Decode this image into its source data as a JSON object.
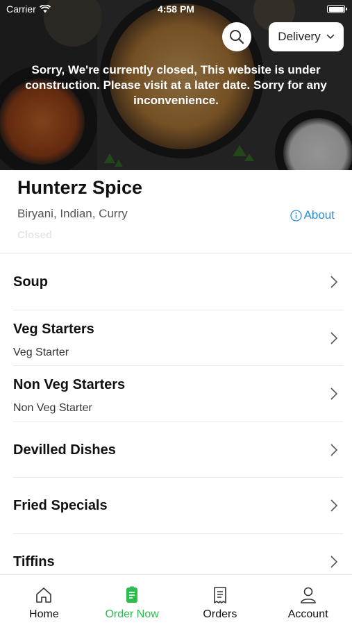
{
  "status_bar": {
    "carrier": "Carrier",
    "time": "4:58 PM",
    "battery_level": 1.0
  },
  "header": {
    "search_icon": "search-icon",
    "order_mode": "Delivery",
    "closed_message": "Sorry, We're currently closed, This website is under construction. Please visit at a later date. Sorry for any inconvenience."
  },
  "restaurant": {
    "name": "Hunterz Spice",
    "cuisines": "Biryani, Indian, Curry",
    "about_label": "About",
    "status": "Closed"
  },
  "categories": [
    {
      "title": "Soup",
      "subtitle": ""
    },
    {
      "title": "Veg Starters",
      "subtitle": "Veg Starter"
    },
    {
      "title": "Non Veg Starters",
      "subtitle": "Non Veg Starter"
    },
    {
      "title": "Devilled Dishes",
      "subtitle": ""
    },
    {
      "title": "Fried Specials",
      "subtitle": ""
    },
    {
      "title": "Tiffins",
      "subtitle": ""
    }
  ],
  "tabs": [
    {
      "label": "Home",
      "icon": "home-icon",
      "active": false
    },
    {
      "label": "Order Now",
      "icon": "order-icon",
      "active": true
    },
    {
      "label": "Orders",
      "icon": "receipt-icon",
      "active": false
    },
    {
      "label": "Account",
      "icon": "user-icon",
      "active": false
    }
  ],
  "colors": {
    "accent": "#2bbd4e",
    "link": "#2a8fd6",
    "hero_overlay": "#000000"
  }
}
